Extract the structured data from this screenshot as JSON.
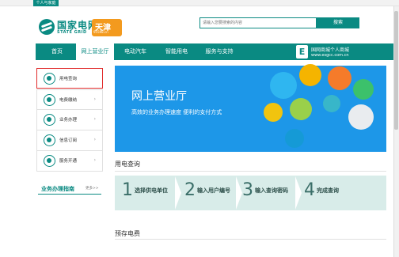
{
  "topbar": {
    "tab_personal": "个人与家庭",
    "tab_company": "",
    "links": [
      "",
      "",
      "",
      "",
      ""
    ]
  },
  "header": {
    "logo_cn": "国家电网",
    "logo_en": "STATE GRID",
    "region_name": "天津",
    "region_site": "95598.cn",
    "search_placeholder": "请输入您要搜索的内容",
    "search_button": "搜索",
    "hot_label": ""
  },
  "nav": {
    "items": [
      "首页",
      "网上营业厅",
      "电动汽车",
      "智能用电",
      "服务与支持"
    ],
    "active_index": 1,
    "mall_title": "国网商城个人商城",
    "mall_url": "www.esgcc.com.cn"
  },
  "sidebar": {
    "items": [
      {
        "label": "用电查询",
        "active": true,
        "icon": "magnifier-icon"
      },
      {
        "label": "电费缴纳",
        "active": false,
        "icon": "coin-icon"
      },
      {
        "label": "业务办理",
        "active": false,
        "icon": "document-icon"
      },
      {
        "label": "信息订阅",
        "active": false,
        "icon": "monitor-icon"
      },
      {
        "label": "服务开通",
        "active": false,
        "icon": "card-icon"
      }
    ],
    "guide_title": "业务办理指南",
    "guide_more": "更多>>",
    "guide_items": [
      "",
      "",
      "",
      "",
      ""
    ]
  },
  "banner": {
    "title": "网上营业厅",
    "subtitle": "高效的业务办理速度  便利的支付方式",
    "bubble_icons": [
      "search-icon",
      "card-icon",
      "money-icon",
      "document-icon",
      "edit-icon",
      "computer-icon",
      "tools-icon",
      "mouse-icon"
    ]
  },
  "query": {
    "heading": "用电查询",
    "steps": [
      {
        "num": "1",
        "title": "选择供电单位",
        "sub": ""
      },
      {
        "num": "2",
        "title": "输入用户编号",
        "sub": ""
      },
      {
        "num": "3",
        "title": "输入查询密码",
        "sub": ""
      },
      {
        "num": "4",
        "title": "完成查询",
        "sub": ""
      }
    ]
  },
  "prepay": {
    "heading": "预存电费",
    "links": ""
  },
  "colors": {
    "brand_green": "#0a8a82",
    "banner_blue": "#1d97e8",
    "region_orange": "#f39a1e",
    "active_red": "#e02a2a"
  }
}
